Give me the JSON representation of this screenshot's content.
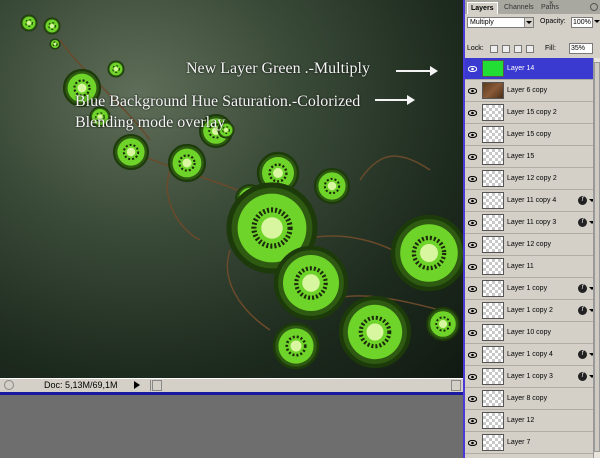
{
  "annotations": {
    "line1": "New Layer Green .-Multiply",
    "line2": "Blue Background Hue Saturation.-Colorized",
    "line3": "Blending mode overlay"
  },
  "statusbar": {
    "doc": "Doc: 5,13M/69,1M"
  },
  "panel": {
    "tabs": [
      {
        "label": "Layers",
        "active": true
      },
      {
        "label": "Channels",
        "active": false
      },
      {
        "label": "Paths",
        "active": false
      }
    ],
    "close_glyph": "×",
    "blend_mode": "Multiply",
    "opacity_label": "Opacity:",
    "opacity_value": "100%",
    "lock_label": "Lock:",
    "fill_label": "Fill:",
    "fill_value": "35%",
    "layers": [
      {
        "name": "Layer 14",
        "thumb": "green",
        "selected": true,
        "fx": false
      },
      {
        "name": "Layer 6 copy",
        "thumb": "brown",
        "selected": false,
        "fx": false
      },
      {
        "name": "Layer 15 copy 2",
        "thumb": "trans",
        "selected": false,
        "fx": false
      },
      {
        "name": "Layer 15 copy",
        "thumb": "trans",
        "selected": false,
        "fx": false
      },
      {
        "name": "Layer 15",
        "thumb": "trans",
        "selected": false,
        "fx": false
      },
      {
        "name": "Layer 12 copy 2",
        "thumb": "trans",
        "selected": false,
        "fx": false
      },
      {
        "name": "Layer 11 copy 4",
        "thumb": "trans",
        "selected": false,
        "fx": true
      },
      {
        "name": "Layer 11 copy 3",
        "thumb": "trans",
        "selected": false,
        "fx": true
      },
      {
        "name": "Layer 12 copy",
        "thumb": "trans",
        "selected": false,
        "fx": false
      },
      {
        "name": "Layer 11",
        "thumb": "trans",
        "selected": false,
        "fx": false
      },
      {
        "name": "Layer 1 copy",
        "thumb": "trans",
        "selected": false,
        "fx": true
      },
      {
        "name": "Layer 1 copy 2",
        "thumb": "trans",
        "selected": false,
        "fx": true
      },
      {
        "name": "Layer 10 copy",
        "thumb": "trans",
        "selected": false,
        "fx": false
      },
      {
        "name": "Layer 1 copy 4",
        "thumb": "trans",
        "selected": false,
        "fx": true
      },
      {
        "name": "Layer 1 copy 3",
        "thumb": "trans",
        "selected": false,
        "fx": true
      },
      {
        "name": "Layer 8 copy",
        "thumb": "trans",
        "selected": false,
        "fx": false
      },
      {
        "name": "Layer 12",
        "thumb": "trans",
        "selected": false,
        "fx": false
      },
      {
        "name": "Layer 7",
        "thumb": "trans",
        "selected": false,
        "fx": false
      }
    ]
  },
  "colors": {
    "selection": "#3a3ad0",
    "panel_bg": "#d4d0c8",
    "kiwi_green": "#6fd42a",
    "layer14_thumb": "#22dd33"
  }
}
